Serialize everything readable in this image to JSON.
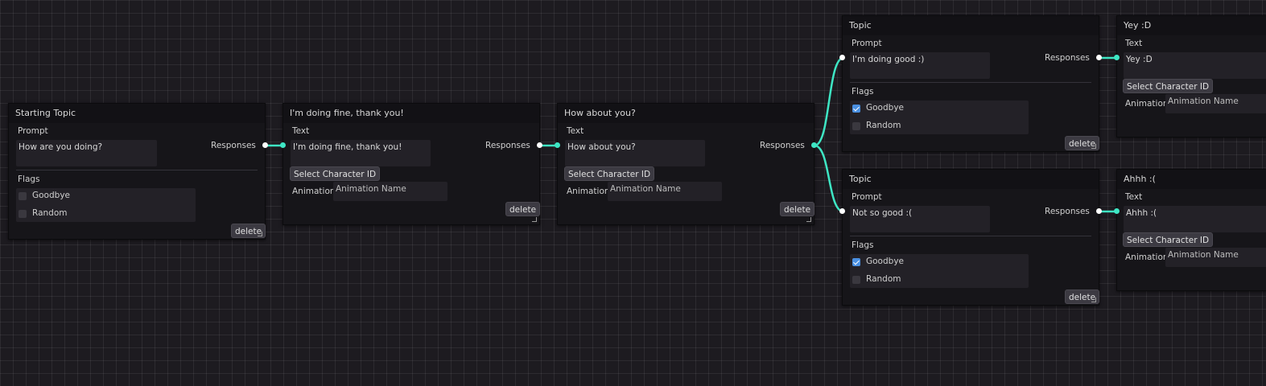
{
  "colors": {
    "wire": "#3ee6c4",
    "port_out": "#ffffff",
    "port_in": "#3ee6c4",
    "checkbox_checked": "#4a90e2"
  },
  "nodes": {
    "start": {
      "title": "Starting Topic",
      "prompt_label": "Prompt",
      "prompt_value": "How are you doing?",
      "responses_label": "Responses",
      "flags_label": "Flags",
      "flags": [
        {
          "label": "Goodbye",
          "checked": false
        },
        {
          "label": "Random",
          "checked": false
        }
      ],
      "delete_label": "delete"
    },
    "fine": {
      "title": "I'm doing fine, thank you!",
      "text_label": "Text",
      "text_value": "I'm doing fine, thank you!",
      "responses_label": "Responses",
      "select_label": "Select Character ID",
      "animation_label": "Animation",
      "animation_placeholder": "Animation Name",
      "delete_label": "delete"
    },
    "howabout": {
      "title": "How about you?",
      "text_label": "Text",
      "text_value": "How about you?",
      "responses_label": "Responses",
      "select_label": "Select Character ID",
      "animation_label": "Animation",
      "animation_placeholder": "Animation Name",
      "delete_label": "delete"
    },
    "topic1": {
      "title": "Topic",
      "prompt_label": "Prompt",
      "prompt_value": "I'm doing good :)",
      "responses_label": "Responses",
      "flags_label": "Flags",
      "flags": [
        {
          "label": "Goodbye",
          "checked": true
        },
        {
          "label": "Random",
          "checked": false
        }
      ],
      "delete_label": "delete"
    },
    "topic2": {
      "title": "Topic",
      "prompt_label": "Prompt",
      "prompt_value": "Not so good :(",
      "responses_label": "Responses",
      "flags_label": "Flags",
      "flags": [
        {
          "label": "Goodbye",
          "checked": true
        },
        {
          "label": "Random",
          "checked": false
        }
      ],
      "delete_label": "delete"
    },
    "yey": {
      "title": "Yey :D",
      "text_label": "Text",
      "text_value": "Yey :D",
      "select_label": "Select Character ID",
      "animation_label": "Animation",
      "animation_placeholder": "Animation Name"
    },
    "ahhh": {
      "title": "Ahhh :(",
      "text_label": "Text",
      "text_value": "Ahhh :(",
      "select_label": "Select Character ID",
      "animation_label": "Animation",
      "animation_placeholder": "Animation Name"
    }
  }
}
